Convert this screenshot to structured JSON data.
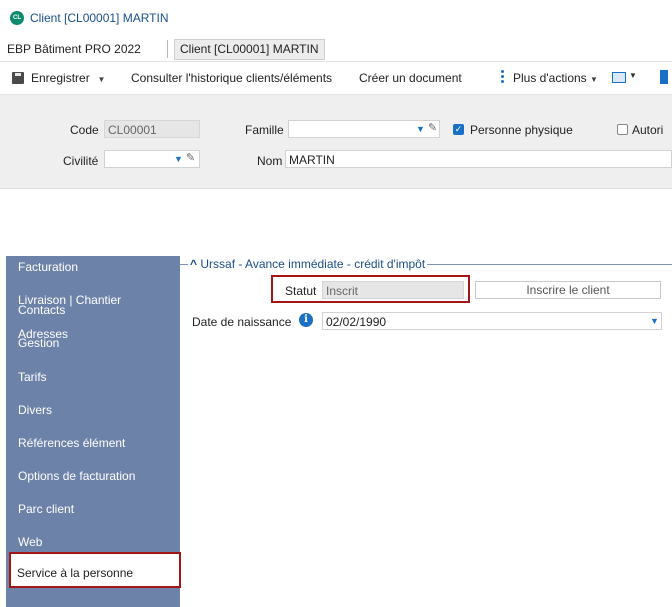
{
  "window": {
    "title": "Client [CL00001] MARTIN",
    "logo_text": "CL"
  },
  "breadcrumb": {
    "app": "EBP Bâtiment PRO 2022",
    "current": "Client [CL00001] MARTIN"
  },
  "toolbar": {
    "save_label": "Enregistrer",
    "history_label": "Consulter l'historique clients/éléments",
    "create_doc_label": "Créer un document",
    "more_label": "Plus d'actions"
  },
  "header": {
    "code_label": "Code",
    "code_value": "CL00001",
    "famille_label": "Famille",
    "famille_value": "",
    "personne_physique_label": "Personne physique",
    "personne_physique_checked": true,
    "autoris_label": "Autori",
    "autoris_checked": false,
    "civilite_label": "Civilité",
    "civilite_value": "",
    "nom_label": "Nom",
    "nom_value": "MARTIN"
  },
  "sidebar": {
    "items": [
      {
        "label": "Facturation"
      },
      {
        "label": "Livraison | Chantier"
      },
      {
        "label": "Adresses"
      },
      {
        "label": "Contacts"
      },
      {
        "label": "Gestion"
      },
      {
        "label": "Tarifs"
      },
      {
        "label": "Divers"
      },
      {
        "label": "Références élément"
      },
      {
        "label": "Options de facturation"
      },
      {
        "label": "Parc client"
      },
      {
        "label": "Web"
      },
      {
        "label": "Service à la personne"
      }
    ],
    "active_index": 11
  },
  "section": {
    "collapse_glyph": "^",
    "title": "Urssaf - Avance immédiate - crédit d'impôt",
    "statut_label": "Statut",
    "statut_value": "Inscrit",
    "inscrire_button": "Inscrire le client",
    "date_label": "Date de naissance",
    "date_value": "02/02/1990"
  },
  "colors": {
    "sidebar_bg": "#6d82a9",
    "highlight_border": "#a31616",
    "accent": "#1a6fc7",
    "title_text": "#1a4f8b"
  }
}
